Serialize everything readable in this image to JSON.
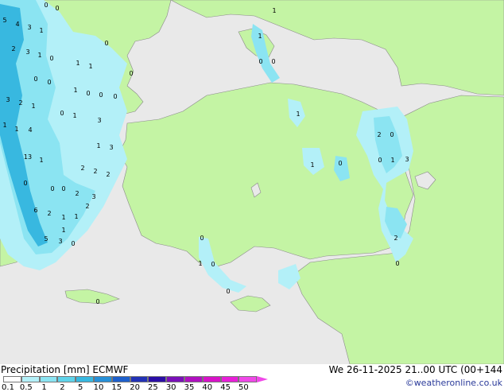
{
  "footer": {
    "title": "Precipitation [mm]  ECMWF",
    "datetime": "We 26-11-2025 21..00 UTC (00+144",
    "credit": "©weatheronline.co.uk"
  },
  "legend": {
    "ticks": [
      "0.1",
      "0.5",
      "1",
      "2",
      "5",
      "10",
      "15",
      "20",
      "25",
      "30",
      "35",
      "40",
      "45",
      "50"
    ],
    "colors": [
      "#fefefe",
      "#b3f0f8",
      "#8be4f2",
      "#5fd3ea",
      "#38b8e0",
      "#2790d8",
      "#1f60cc",
      "#2332b6",
      "#2a0ea6",
      "#7a10b8",
      "#b010c0",
      "#d812c8",
      "#e81ed8",
      "#f048e8"
    ]
  },
  "colors": {
    "sea": "#e9e9e9",
    "land": "#c4f4a4",
    "border": "#8a8a8a",
    "light_precip": "#b3f0f8",
    "mid_precip": "#8be4f2",
    "heavy_precip": "#38b8e0"
  },
  "map_labels": [
    "0",
    "0",
    "1",
    "5",
    "4",
    "3",
    "1",
    "2",
    "1",
    "3",
    "1",
    "0",
    "1",
    "1",
    "0",
    "0",
    "0",
    "0",
    "0",
    "1",
    "0",
    "0",
    "0",
    "0",
    "3",
    "2",
    "1",
    "1",
    "3",
    "4",
    "1",
    "0",
    "1",
    "2",
    "1",
    "3",
    "0",
    "1",
    "13",
    "1",
    "2",
    "2",
    "2",
    "0",
    "0",
    "0",
    "3",
    "6",
    "2",
    "1",
    "2",
    "5",
    "1",
    "3",
    "0",
    "0",
    "0",
    "1",
    "0",
    "0",
    "1",
    "1",
    "0",
    "2",
    "0",
    "1",
    "3",
    "2",
    "0"
  ]
}
